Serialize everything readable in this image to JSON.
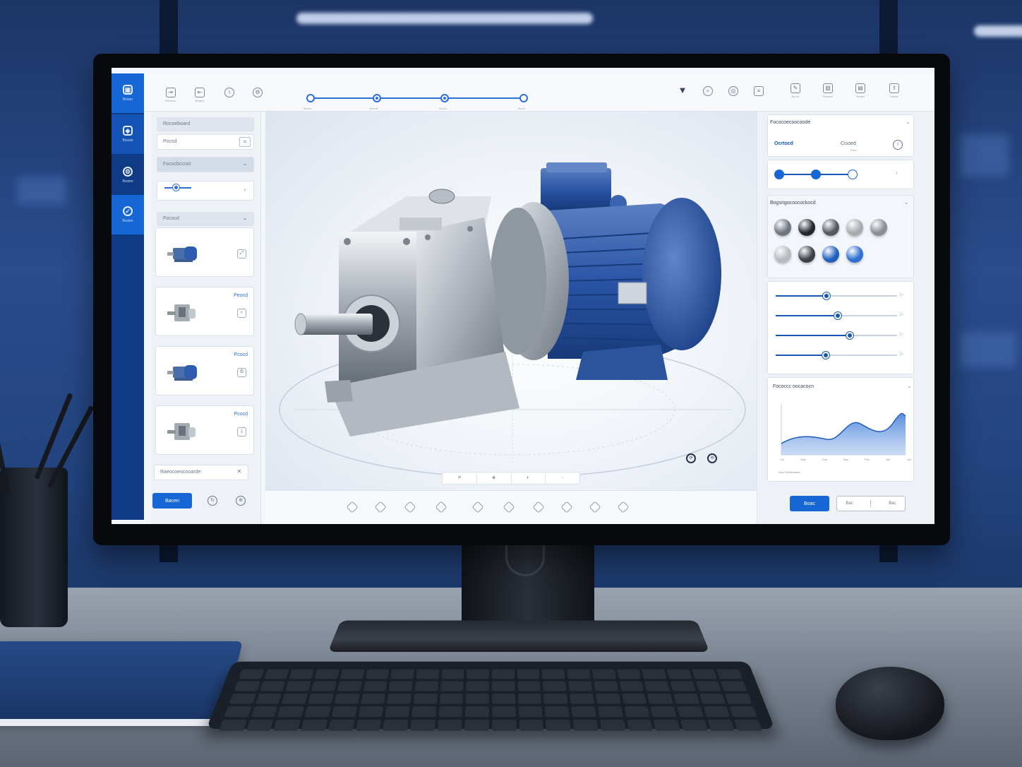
{
  "app": {
    "accent_color": "#1766d6",
    "nav": [
      {
        "label": "Bsoun",
        "icon": "cube-icon",
        "active": true
      },
      {
        "label": "Bssuin",
        "icon": "package-icon",
        "active": true
      },
      {
        "label": "Bvsion",
        "icon": "gear-icon",
        "active": false
      },
      {
        "label": "Bvsion",
        "icon": "check-icon",
        "active": true
      }
    ]
  },
  "topbar": {
    "tools_left": [
      {
        "icon": "import-icon",
        "label": "Breatum"
      },
      {
        "icon": "export-icon",
        "label": "Bragus"
      },
      {
        "icon": "info-icon",
        "label": ""
      },
      {
        "icon": "settings-icon",
        "label": ""
      }
    ],
    "steps": [
      {
        "label": "Bocus"
      },
      {
        "label": "Brocst"
      },
      {
        "label": "Bocun"
      },
      {
        "label": "Bocur"
      }
    ],
    "tools_right": [
      {
        "icon": "filter-icon"
      },
      {
        "icon": "zoom-icon"
      },
      {
        "icon": "target-icon"
      },
      {
        "icon": "layers-icon"
      },
      {
        "icon": "edit-icon",
        "label": "Bocur"
      },
      {
        "icon": "image-icon",
        "label": "Breaset"
      },
      {
        "icon": "save-icon",
        "label": "Bruset"
      },
      {
        "icon": "share-icon",
        "label": "Bsurst"
      }
    ]
  },
  "library": {
    "section_title": "Rocoeboard",
    "search_value": "Pocsd",
    "search_icon": "scan-icon",
    "dropdown_label": "Fococbccost",
    "group_title": "Fococd",
    "products": [
      {
        "label": "",
        "color": "blue",
        "action_icon": "expand-icon"
      },
      {
        "label": "Peocd",
        "color": "silver",
        "action_icon": "zoom-icon"
      },
      {
        "label": "Pcocd",
        "color": "blue",
        "action_icon": "settings-icon"
      },
      {
        "label": "Pcocd",
        "color": "silver",
        "action_icon": "download-icon"
      }
    ],
    "footer_field": "Raeocoeocooarde",
    "primary_button": "Bacen"
  },
  "props": {
    "section1_title": "Fococoecoocoode",
    "option_selected": "Ocrtocd",
    "option_other": "Cisoed",
    "option_other_sub": "Pcoc",
    "section2_title": "Bogsrigocoocockocd",
    "swatches": [
      "#6e757f",
      "#23262c",
      "#54595f",
      "#a7abb0",
      "#8a8e94",
      "#b6babf",
      "#3b3f46",
      "#1f5fbf",
      "#2e6fd1"
    ],
    "sliders": [
      0.42,
      0.51,
      0.61,
      0.41
    ],
    "chart_title": "Fococcc oocacocn",
    "chart_ticks": [
      "Ctc",
      "Bac",
      "Dac",
      "Bac",
      "Pac",
      "Jac",
      "ocs"
    ],
    "chart_caption": "Wac Pactacoaaa",
    "primary_button": "Boac",
    "secondary_left": "Bac",
    "secondary_right": "Bac"
  }
}
